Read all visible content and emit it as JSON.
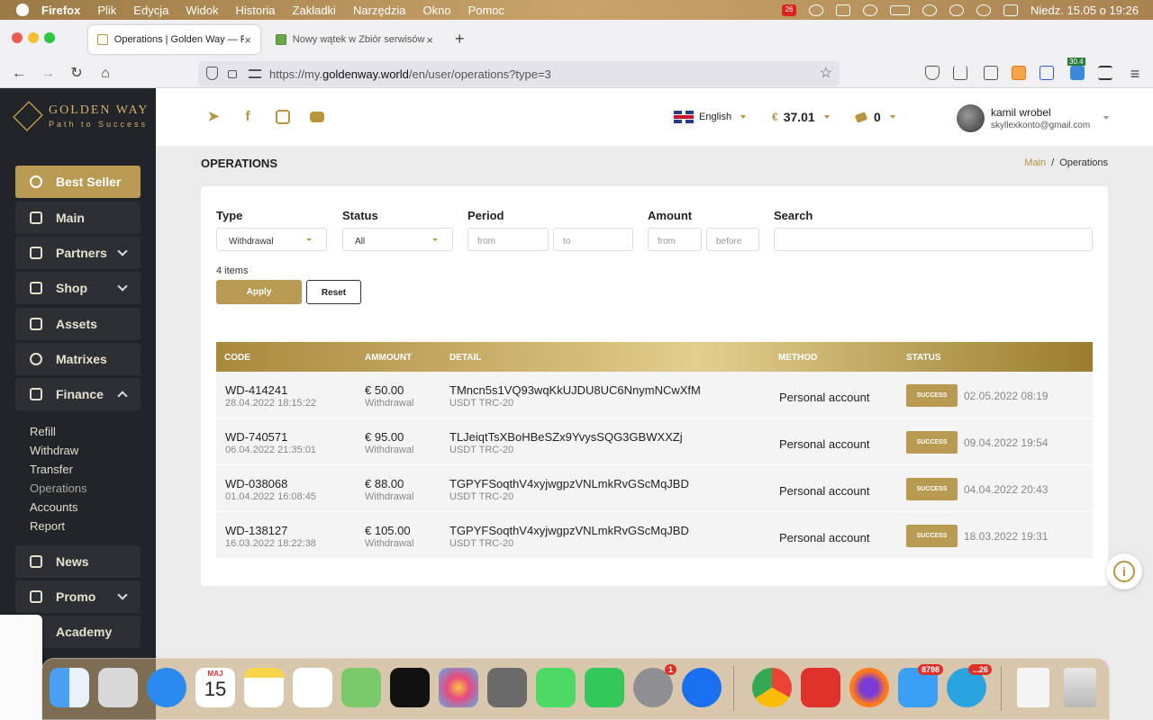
{
  "os_menubar": {
    "app": "Firefox",
    "items": [
      "Plik",
      "Edycja",
      "Widok",
      "Historia",
      "Zakładki",
      "Narzędzia",
      "Okno",
      "Pomoc"
    ],
    "calendar_badge": "26",
    "clock": "Niedz. 15.05 o 19:26"
  },
  "browser": {
    "tabs": [
      {
        "title": "Operations | Golden Way — Path",
        "active": true
      },
      {
        "title": "Nowy wątek w Zbiór serwisów z",
        "active": false
      }
    ],
    "url_prefix": "https://my.",
    "url_host": "goldenway.world",
    "url_path": "/en/user/operations?type=3",
    "ext_badge": "30.4"
  },
  "sidebar": {
    "logo_title": "GOLDEN WAY",
    "logo_subtitle": "Path to Success",
    "items": [
      {
        "label": "Best Seller",
        "icon": "medal-icon",
        "active": true
      },
      {
        "label": "Main",
        "icon": "cube-icon"
      },
      {
        "label": "Partners",
        "icon": "handshake-icon",
        "expandable": true
      },
      {
        "label": "Shop",
        "icon": "shop-icon",
        "expandable": true
      },
      {
        "label": "Assets",
        "icon": "chart-line-icon"
      },
      {
        "label": "Matrixes",
        "icon": "nodes-icon"
      },
      {
        "label": "Finance",
        "icon": "money-icon",
        "expanded": true
      },
      {
        "label": "News",
        "icon": "bookmark-icon"
      },
      {
        "label": "Promo",
        "icon": "trophy-icon",
        "expandable": true
      },
      {
        "label": "Academy",
        "icon": "cap-icon"
      }
    ],
    "finance_sub": [
      "Refill",
      "Withdraw",
      "Transfer",
      "Operations",
      "Accounts",
      "Report"
    ]
  },
  "topbar": {
    "social": [
      "telegram-icon",
      "facebook-icon",
      "instagram-icon",
      "youtube-icon"
    ],
    "language": "English",
    "balance_currency": "€",
    "balance": "37.01",
    "points": "0",
    "user_name": "kamil wrobel",
    "user_email": "skyllexkonto@gmail.com"
  },
  "page": {
    "title": "OPERATIONS",
    "breadcrumb_home": "Main",
    "breadcrumb_sep": "/",
    "breadcrumb_current": "Operations"
  },
  "filters": {
    "type_label": "Type",
    "type_value": "Withdrawal",
    "status_label": "Status",
    "status_value": "All",
    "period_label": "Period",
    "period_from": "from",
    "period_to": "to",
    "amount_label": "Amount",
    "amount_from": "from",
    "amount_before": "before",
    "search_label": "Search",
    "count": "4 items",
    "apply": "Apply",
    "reset": "Reset"
  },
  "table": {
    "headers": [
      "CODE",
      "AMMOUNT",
      "DETAIL",
      "METHOD",
      "STATUS"
    ],
    "rows": [
      {
        "code": "WD-414241",
        "created": "28.04.2022 18:15:22",
        "amount": "€ 50.00",
        "kind": "Withdrawal",
        "detail": "TMncn5s1VQ93wqKkUJDU8UC6NnymNCwXfM",
        "network": "USDT TRC-20",
        "method": "Personal account",
        "status": "SUCCESS",
        "status_date": "02.05.2022 08:19"
      },
      {
        "code": "WD-740571",
        "created": "06.04.2022 21:35:01",
        "amount": "€ 95.00",
        "kind": "Withdrawal",
        "detail": "TLJeiqtTsXBoHBeSZx9YvysSQG3GBWXXZj",
        "network": "USDT TRC-20",
        "method": "Personal account",
        "status": "SUCCESS",
        "status_date": "09.04.2022 19:54"
      },
      {
        "code": "WD-038068",
        "created": "01.04.2022 16:08:45",
        "amount": "€ 88.00",
        "kind": "Withdrawal",
        "detail": "TGPYFSoqthV4xyjwgpzVNLmkRvGScMqJBD",
        "network": "USDT TRC-20",
        "method": "Personal account",
        "status": "SUCCESS",
        "status_date": "04.04.2022 20:43"
      },
      {
        "code": "WD-138127",
        "created": "16.03.2022 18:22:38",
        "amount": "€ 105.00",
        "kind": "Withdrawal",
        "detail": "TGPYFSoqthV4xyjwgpzVNLmkRvGScMqJBD",
        "network": "USDT TRC-20",
        "method": "Personal account",
        "status": "SUCCESS",
        "status_date": "18.03.2022 19:31"
      }
    ]
  },
  "dock": {
    "apps": [
      "finder-icon",
      "launchpad-icon",
      "safari-icon",
      "calendar-icon",
      "notes-icon",
      "reminders-icon",
      "maps-icon",
      "apple-tv-icon",
      "photos-icon",
      "calculator-icon",
      "messages-icon",
      "facetime-icon",
      "system-preferences-icon",
      "teamviewer-icon",
      "chrome-icon",
      "anydesk-icon",
      "firefox-icon",
      "mail-icon",
      "telegram-icon",
      "archive-icon",
      "trash-icon"
    ],
    "calendar_month": "MAJ",
    "calendar_day": "15",
    "settings_badge": "1",
    "mail_badge": "8798",
    "telegram_badge": "...26"
  },
  "colors": {
    "accent": "#b99a52",
    "sidebar": "#212529"
  }
}
